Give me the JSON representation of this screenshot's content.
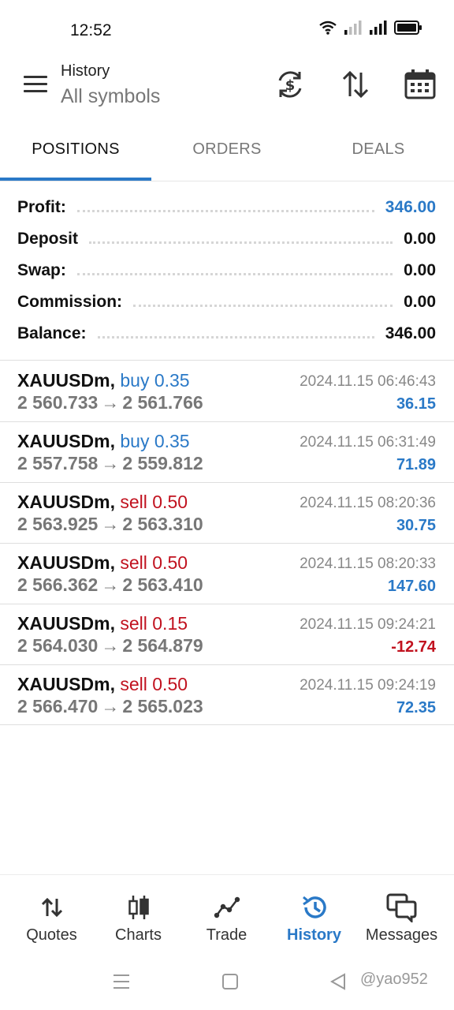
{
  "status_bar": {
    "time": "12:52"
  },
  "header": {
    "title": "History",
    "subtitle": "All symbols"
  },
  "tabs": [
    {
      "label": "POSITIONS",
      "active": true
    },
    {
      "label": "ORDERS",
      "active": false
    },
    {
      "label": "DEALS",
      "active": false
    }
  ],
  "summary": {
    "profit": {
      "label": "Profit:",
      "value": "346.00"
    },
    "deposit": {
      "label": "Deposit",
      "value": "0.00"
    },
    "swap": {
      "label": "Swap:",
      "value": "0.00"
    },
    "commission": {
      "label": "Commission:",
      "value": "0.00"
    },
    "balance": {
      "label": "Balance:",
      "value": "346.00"
    }
  },
  "deals": [
    {
      "symbol": "XAUUSDm,",
      "type": "buy 0.35",
      "side": "buy",
      "open": "2 560.733",
      "arrow": "→",
      "close": "2 561.766",
      "time": "2024.11.15 06:46:43",
      "profit": "36.15"
    },
    {
      "symbol": "XAUUSDm,",
      "type": "buy 0.35",
      "side": "buy",
      "open": "2 557.758",
      "arrow": "→",
      "close": "2 559.812",
      "time": "2024.11.15 06:31:49",
      "profit": "71.89"
    },
    {
      "symbol": "XAUUSDm,",
      "type": "sell 0.50",
      "side": "sell",
      "open": "2 563.925",
      "arrow": "→",
      "close": "2 563.310",
      "time": "2024.11.15 08:20:36",
      "profit": "30.75"
    },
    {
      "symbol": "XAUUSDm,",
      "type": "sell 0.50",
      "side": "sell",
      "open": "2 566.362",
      "arrow": "→",
      "close": "2 563.410",
      "time": "2024.11.15 08:20:33",
      "profit": "147.60"
    },
    {
      "symbol": "XAUUSDm,",
      "type": "sell 0.15",
      "side": "sell",
      "open": "2 564.030",
      "arrow": "→",
      "close": "2 564.879",
      "time": "2024.11.15 09:24:21",
      "profit": "-12.74"
    },
    {
      "symbol": "XAUUSDm,",
      "type": "sell 0.50",
      "side": "sell",
      "open": "2 566.470",
      "arrow": "→",
      "close": "2 565.023",
      "time": "2024.11.15 09:24:19",
      "profit": "72.35"
    }
  ],
  "bottom_nav": [
    {
      "label": "Quotes",
      "icon": "quotes-icon",
      "active": false
    },
    {
      "label": "Charts",
      "icon": "candlestick-icon",
      "active": false
    },
    {
      "label": "Trade",
      "icon": "trade-icon",
      "active": false
    },
    {
      "label": "History",
      "icon": "history-icon",
      "active": true
    },
    {
      "label": "Messages",
      "icon": "messages-icon",
      "active": false
    }
  ],
  "watermark": "@yao952",
  "colors": {
    "accent": "#2a79c7",
    "loss": "#c1121f",
    "muted": "#777777"
  }
}
